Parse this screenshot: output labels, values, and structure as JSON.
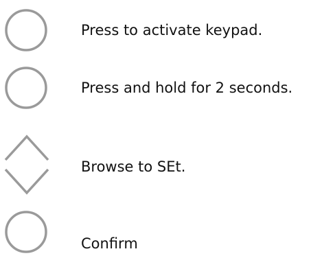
{
  "steps": [
    {
      "icon": "circle-button-icon",
      "text": "Press to activate keypad."
    },
    {
      "icon": "circle-button-icon",
      "text": "Press and hold for 2 seconds."
    },
    {
      "icon": "up-down-arrows-icon",
      "text": "Browse to SEt."
    },
    {
      "icon": "circle-button-icon",
      "text": "Confirm"
    }
  ],
  "colors": {
    "icon_stroke": "#9a9a9a",
    "text": "#111111",
    "background": "#ffffff"
  }
}
